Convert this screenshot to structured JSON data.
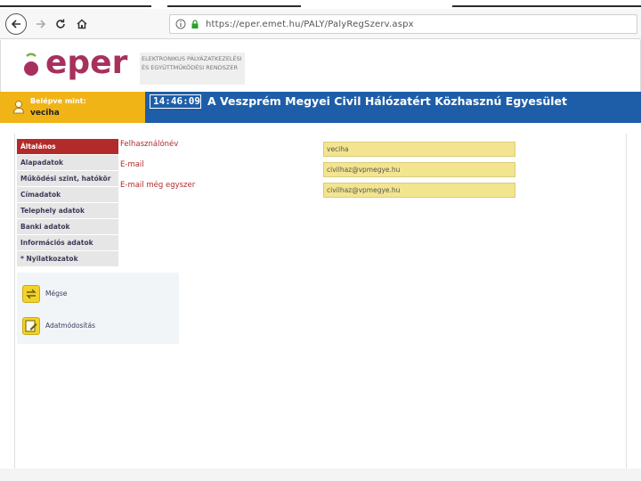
{
  "browser": {
    "url": "https://eper.emet.hu/PALY/PalyRegSzerv.aspx"
  },
  "logo": {
    "word": "eper",
    "subtitle_line1": "ELEKTRONIKUS PÁLYÁZATKEZELÉSI",
    "subtitle_line2": "ÉS EGYÜTTMŰKÖDÉSI RENDSZER"
  },
  "header": {
    "login_label": "Belépve mint:",
    "login_user": "veciha",
    "clock": "14:46:09",
    "org_name": "A Veszprém Megyei Civil Hálózatért Közhasznú Egyesület"
  },
  "sidebar": {
    "items": [
      {
        "label": "Általános"
      },
      {
        "label": "Alapadatok"
      },
      {
        "label": "Működési szint, hatókör"
      },
      {
        "label": "Címadatok"
      },
      {
        "label": "Telephely adatok"
      },
      {
        "label": "Banki adatok"
      },
      {
        "label": "Információs adatok"
      },
      {
        "label": "* Nyilatkozatok"
      }
    ]
  },
  "form": {
    "rows": [
      {
        "label": "Felhasználónév",
        "value": "veciha"
      },
      {
        "label": "E-mail",
        "value": "civilhaz@vpmegye.hu"
      },
      {
        "label": "E-mail még egyszer",
        "value": "civilhaz@vpmegye.hu"
      }
    ]
  },
  "actions": {
    "cancel_label": "Mégse",
    "modify_label": "Adatmódosítás"
  },
  "colors": {
    "header_blue": "#1e5ea8",
    "login_yellow": "#f0b417",
    "active_red": "#b32a2a",
    "field_yellow": "#f3e58f",
    "logo_magenta": "#a8305c"
  }
}
